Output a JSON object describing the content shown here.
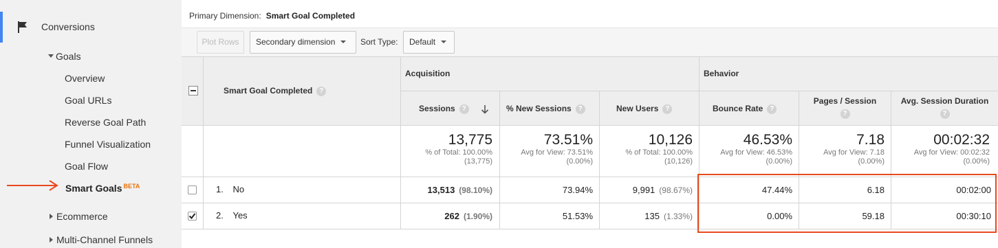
{
  "sidebar": {
    "conversions": "Conversions",
    "goals": "Goals",
    "items": [
      {
        "label": "Overview"
      },
      {
        "label": "Goal URLs"
      },
      {
        "label": "Reverse Goal Path"
      },
      {
        "label": "Funnel Visualization"
      },
      {
        "label": "Goal Flow"
      }
    ],
    "active_item": {
      "label": "Smart Goals",
      "badge": "BETA"
    },
    "ecommerce": "Ecommerce",
    "multichannel": "Multi-Channel Funnels"
  },
  "primary_dimension": {
    "label": "Primary Dimension:",
    "value": "Smart Goal Completed"
  },
  "toolbar": {
    "plot_rows": "Plot Rows",
    "secondary_dimension": "Secondary dimension",
    "sort_type_label": "Sort Type:",
    "sort_type_value": "Default"
  },
  "table": {
    "dimension_header": "Smart Goal Completed",
    "groups": {
      "acquisition": "Acquisition",
      "behavior": "Behavior"
    },
    "columns": {
      "sessions": "Sessions",
      "new_sessions": "% New Sessions",
      "new_users": "New Users",
      "bounce_rate": "Bounce Rate",
      "pages_session": "Pages / Session",
      "avg_duration": "Avg. Session Duration"
    },
    "totals": {
      "sessions": {
        "value": "13,775",
        "sub1": "% of Total: 100.00%",
        "sub2": "(13,775)"
      },
      "new_sessions": {
        "value": "73.51%",
        "sub1": "Avg for View: 73.51%",
        "sub2": "(0.00%)"
      },
      "new_users": {
        "value": "10,126",
        "sub1": "% of Total: 100.00%",
        "sub2": "(10,126)"
      },
      "bounce_rate": {
        "value": "46.53%",
        "sub1": "Avg for View: 46.53%",
        "sub2": "(0.00%)"
      },
      "pages_session": {
        "value": "7.18",
        "sub1": "Avg for View: 7.18",
        "sub2": "(0.00%)"
      },
      "avg_duration": {
        "value": "00:02:32",
        "sub1": "Avg for View: 00:02:32",
        "sub2": "(0.00%)"
      }
    },
    "rows": [
      {
        "index": "1.",
        "label": "No",
        "checked": false,
        "sessions": "13,513",
        "sessions_pct": "(98.10%)",
        "new_sessions": "73.94%",
        "new_users": "9,991",
        "new_users_pct": "(98.67%)",
        "bounce_rate": "47.44%",
        "pages_session": "6.18",
        "avg_duration": "00:02:00"
      },
      {
        "index": "2.",
        "label": "Yes",
        "checked": true,
        "sessions": "262",
        "sessions_pct": "(1.90%)",
        "new_sessions": "51.53%",
        "new_users": "135",
        "new_users_pct": "(1.33%)",
        "bounce_rate": "0.00%",
        "pages_session": "59.18",
        "avg_duration": "00:30:10"
      }
    ]
  },
  "colors": {
    "accent_blue": "#4285f4",
    "highlight_orange": "#e8491d",
    "beta_orange": "#e8710a"
  }
}
